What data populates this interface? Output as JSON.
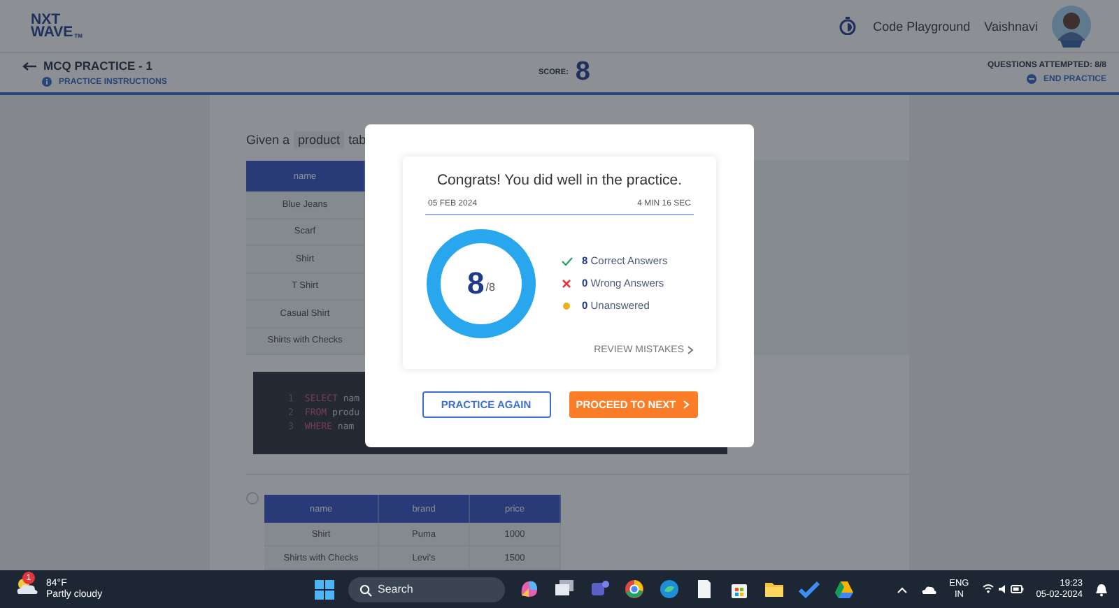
{
  "header": {
    "logo": {
      "line1": "NXT",
      "line2": "WAVE",
      "mark": "TM"
    },
    "link": "Code Playground",
    "user": "Vaishnavi"
  },
  "practice_bar": {
    "title": "MCQ PRACTICE - 1",
    "instructions": "PRACTICE INSTRUCTIONS",
    "score_label": "SCORE:",
    "score": "8",
    "attempted": "QUESTIONS ATTEMPTED: 8/8",
    "end": "END PRACTICE"
  },
  "question": {
    "prompt_start": "Given a",
    "code_word": "product",
    "prompt_rest": "tab",
    "table": {
      "columns": [
        "name"
      ],
      "rows": [
        [
          "Blue Jeans"
        ],
        [
          "Scarf"
        ],
        [
          "Shirt"
        ],
        [
          "T Shirt"
        ],
        [
          "Casual Shirt"
        ],
        [
          "Shirts with Checks"
        ]
      ]
    },
    "code": [
      {
        "number": "1",
        "keyword": "SELECT",
        "rest": "nam"
      },
      {
        "number": "2",
        "keyword": "FROM",
        "rest": "produ"
      },
      {
        "number": "3",
        "keyword": "WHERE",
        "rest": "nam"
      }
    ],
    "options": [
      {
        "selected": false,
        "table": {
          "columns": [
            "name",
            "brand",
            "price"
          ],
          "rows": [
            [
              "Shirt",
              "Puma",
              "1000"
            ],
            [
              "Shirts with Checks",
              "Levi's",
              "1500"
            ]
          ]
        }
      }
    ]
  },
  "result": {
    "title": "Congrats! You did well in the practice.",
    "date": "05 FEB 2024",
    "duration": "4 MIN 16 SEC",
    "ring": {
      "value": "8",
      "total": "/8"
    },
    "stats": [
      {
        "kind": "correct",
        "count": "8",
        "label": "Correct Answers"
      },
      {
        "kind": "wrong",
        "count": "0",
        "label": "Wrong Answers"
      },
      {
        "kind": "unanswered",
        "count": "0",
        "label": "Unanswered"
      }
    ],
    "review": "REVIEW MISTAKES",
    "buttons": [
      {
        "kind": "outline",
        "label": "PRACTICE AGAIN"
      },
      {
        "kind": "primary",
        "label": "PROCEED TO NEXT"
      }
    ]
  },
  "taskbar": {
    "weather": {
      "badge": "1",
      "temp": "84°F",
      "text": "Partly cloudy"
    },
    "search": {
      "placeholder": "Search"
    },
    "language": {
      "line1": "ENG",
      "line2": "IN"
    },
    "time": "19:23",
    "date": "05-02-2024"
  }
}
